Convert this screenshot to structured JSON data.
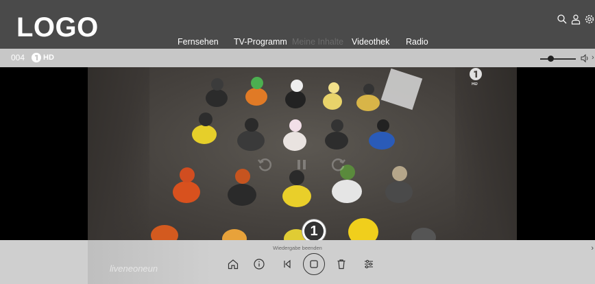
{
  "header": {
    "logo": "LOGO",
    "nav": [
      {
        "label": "Fernsehen",
        "active": false
      },
      {
        "label": "TV-Programm",
        "active": false
      },
      {
        "label": "Meine Inhalte",
        "active": true
      },
      {
        "label": "Videothek",
        "active": false
      },
      {
        "label": "Radio",
        "active": false
      }
    ],
    "icons": [
      "search-icon",
      "user-icon",
      "settings-icon"
    ]
  },
  "channel": {
    "number": "004",
    "hd_label": "HD",
    "volume_level": 0.3
  },
  "video": {
    "hd_badge": "HD"
  },
  "controls": {
    "stop_label": "Wiedergabe beenden",
    "watermark": "liveneoneun",
    "badge": "1",
    "buttons": [
      "home-icon",
      "info-icon",
      "skip-back-icon",
      "stop-icon",
      "trash-icon",
      "settings-sliders-icon"
    ]
  },
  "colors": {
    "header_bg": "#4a4a4a",
    "channel_bar_bg": "#c7c7c7",
    "bottom_bar_bg": "#cfcfcf",
    "active_nav": "#6b6b6b"
  }
}
